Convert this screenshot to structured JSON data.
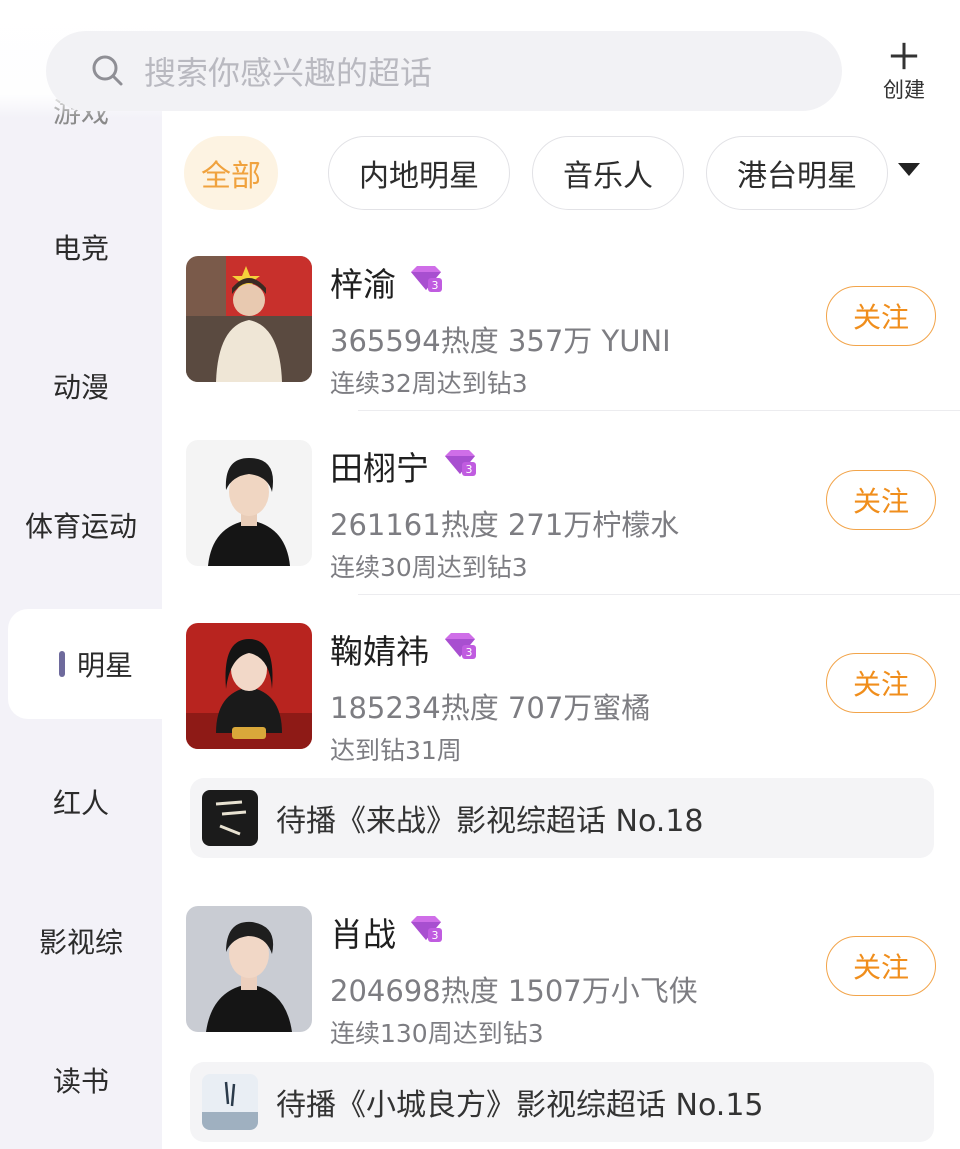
{
  "search": {
    "placeholder": "搜索你感兴趣的超话"
  },
  "create": {
    "label": "创建"
  },
  "sidebar": {
    "items": [
      {
        "label": "游戏"
      },
      {
        "label": "电竞"
      },
      {
        "label": "动漫"
      },
      {
        "label": "体育运动"
      },
      {
        "label": "明星",
        "active": true
      },
      {
        "label": "红人"
      },
      {
        "label": "影视综"
      },
      {
        "label": "读书"
      }
    ]
  },
  "tabs": [
    {
      "label": "全部",
      "active": true
    },
    {
      "label": "内地明星"
    },
    {
      "label": "音乐人"
    },
    {
      "label": "港台明星"
    }
  ],
  "list": [
    {
      "name": "梓渝",
      "stats": "365594热度 357万 YUNI",
      "streak": "连续32周达到钻3",
      "follow": "关注"
    },
    {
      "name": "田栩宁",
      "stats": "261161热度 271万柠檬水",
      "streak": "连续30周达到钻3",
      "follow": "关注"
    },
    {
      "name": "鞠婧祎",
      "stats": "185234热度 707万蜜橘",
      "streak": "达到钻31周",
      "follow": "关注",
      "promo": "待播《来战》影视综超话 No.18"
    },
    {
      "name": "肖战",
      "stats": "204698热度 1507万小飞侠",
      "streak": "连续130周达到钻3",
      "follow": "关注",
      "promo": "待播《小城良方》影视综超话 No.15"
    }
  ],
  "colors": {
    "accent": "#f08e1c",
    "active_tab_bg": "#fdf3e2",
    "sidebar_bg": "#f3f2f8",
    "badge": "#b25bd6"
  }
}
